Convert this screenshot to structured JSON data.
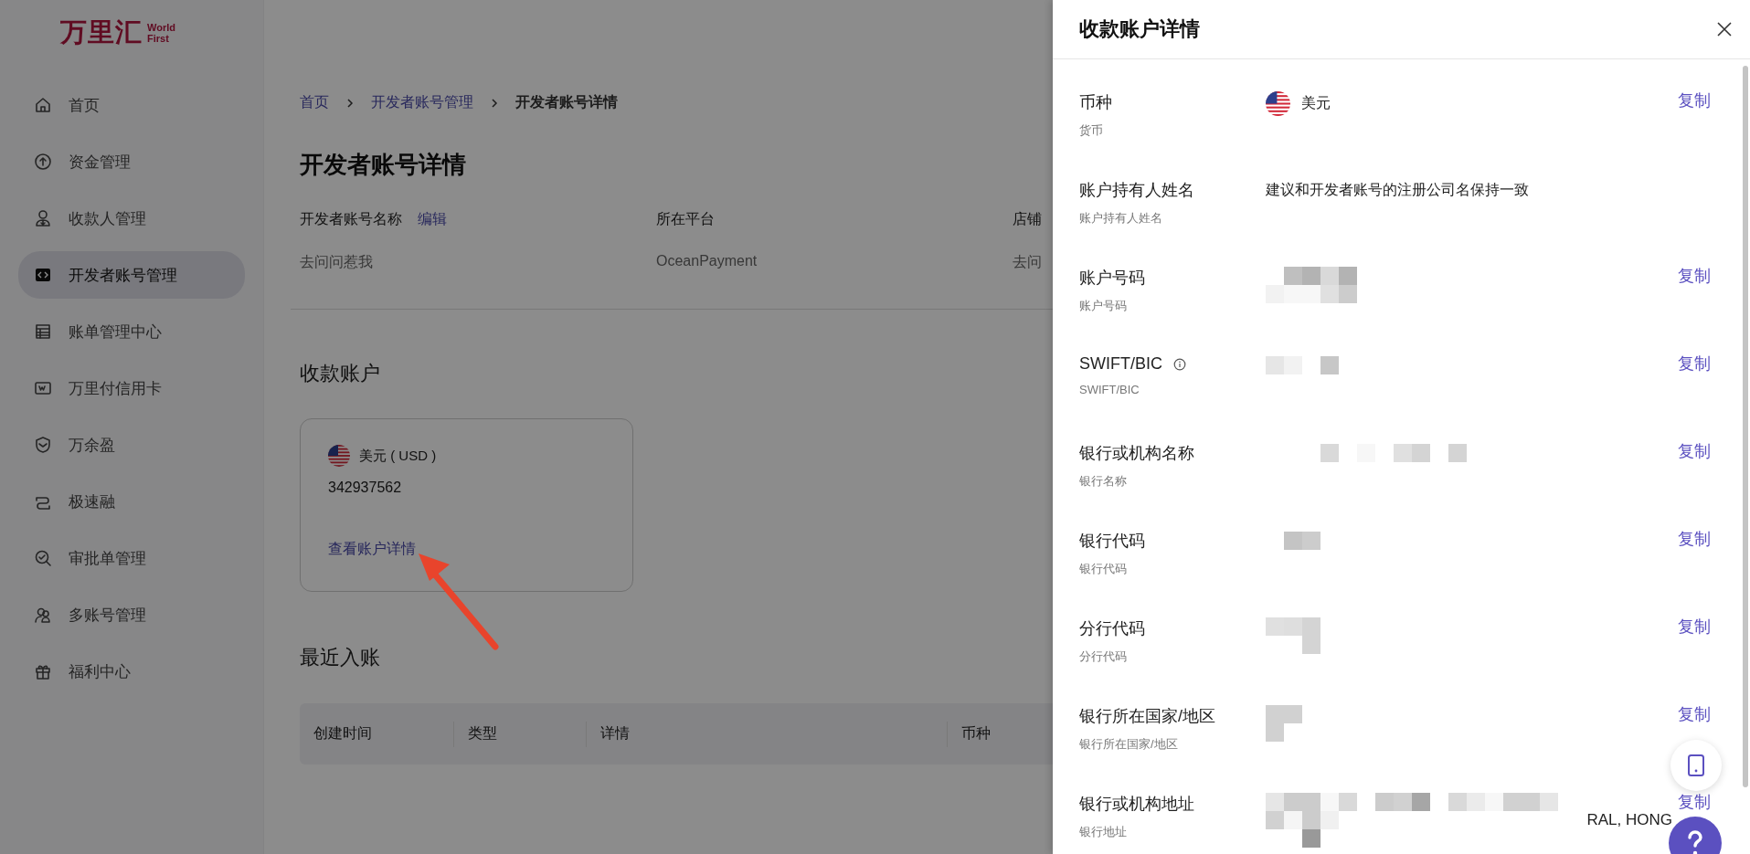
{
  "logo": {
    "mark": "万里汇",
    "wordmark": [
      "World",
      "First"
    ]
  },
  "sidebar": {
    "items": [
      {
        "label": "首页",
        "selected": false
      },
      {
        "label": "资金管理",
        "selected": false
      },
      {
        "label": "收款人管理",
        "selected": false
      },
      {
        "label": "开发者账号管理",
        "selected": true
      },
      {
        "label": "账单管理中心",
        "selected": false
      },
      {
        "label": "万里付信用卡",
        "selected": false
      },
      {
        "label": "万余盈",
        "selected": false
      },
      {
        "label": "极速融",
        "selected": false
      },
      {
        "label": "审批单管理",
        "selected": false
      },
      {
        "label": "多账号管理",
        "selected": false
      },
      {
        "label": "福利中心",
        "selected": false
      }
    ]
  },
  "breadcrumb": [
    {
      "label": "首页",
      "current": false
    },
    {
      "label": "开发者账号管理",
      "current": false
    },
    {
      "label": "开发者账号详情",
      "current": true
    }
  ],
  "page_title": "开发者账号详情",
  "info": [
    {
      "label": "开发者账号名称",
      "action": "编辑",
      "value": "去问问惹我"
    },
    {
      "label": "所在平台",
      "value": "OceanPayment"
    },
    {
      "label": "店铺",
      "value": "去问"
    }
  ],
  "accounts_section": {
    "title": "收款账户",
    "card": {
      "currency": "美元 ( USD )",
      "number": "342937562",
      "link": "查看账户详情"
    }
  },
  "recent_section": {
    "title": "最近入账",
    "table": {
      "columns": [
        "创建时间",
        "类型",
        "详情",
        "币种"
      ]
    }
  },
  "drawer": {
    "title": "收款账户详情",
    "rows": [
      {
        "label": "币种",
        "sublabel": "货币",
        "kind": "flag",
        "value": "美元",
        "copy": "复制"
      },
      {
        "label": "账户持有人姓名",
        "sublabel": "账户持有人姓名",
        "kind": "text",
        "value": "建议和开发者账号的注册公司名保持一致"
      },
      {
        "label": "账户号码",
        "sublabel": "账户号码",
        "kind": "redacted",
        "copy": "复制"
      },
      {
        "label": "SWIFT/BIC",
        "sublabel": "SWIFT/BIC",
        "kind": "redacted",
        "info": true,
        "copy": "复制"
      },
      {
        "label": "银行或机构名称",
        "sublabel": "银行名称",
        "kind": "redacted",
        "copy": "复制"
      },
      {
        "label": "银行代码",
        "sublabel": "银行代码",
        "kind": "redacted",
        "copy": "复制"
      },
      {
        "label": "分行代码",
        "sublabel": "分行代码",
        "kind": "redacted",
        "copy": "复制"
      },
      {
        "label": "银行所在国家/地区",
        "sublabel": "银行所在国家/地区",
        "kind": "redacted",
        "copy": "复制"
      },
      {
        "label": "银行或机构地址",
        "sublabel": "银行地址",
        "kind": "redacted",
        "value": "RAL, HONG",
        "copy": "复制"
      }
    ]
  }
}
